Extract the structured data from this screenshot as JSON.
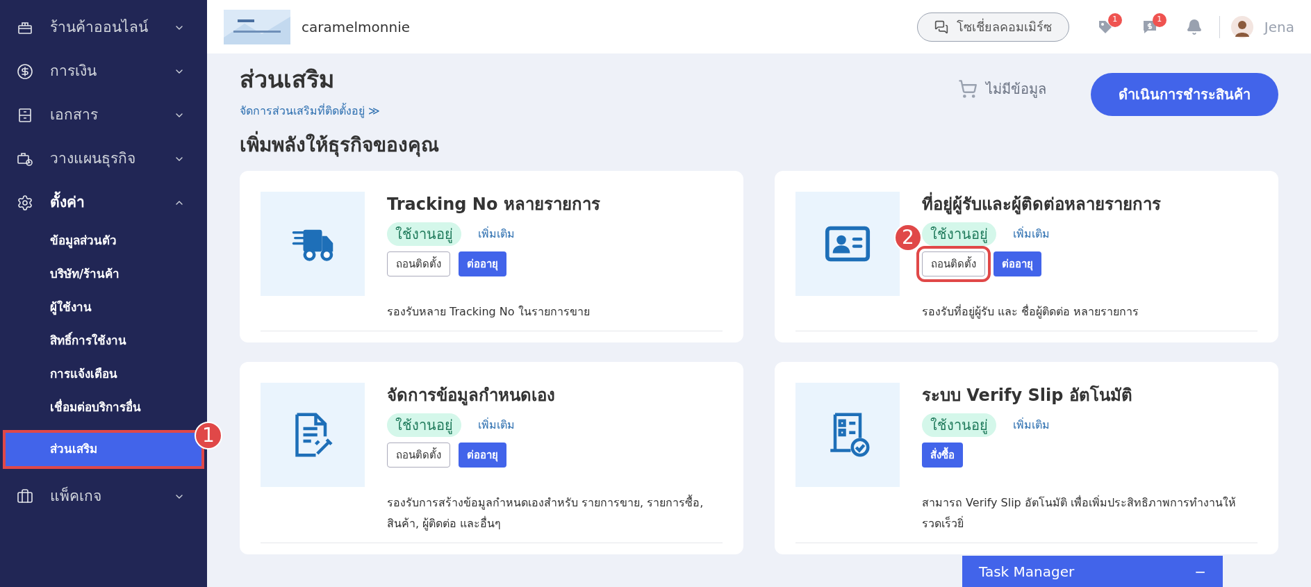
{
  "sidebar": {
    "items": [
      {
        "kind": "menu",
        "label": "ร้านค้าออนไลน์",
        "expanded": false
      },
      {
        "kind": "menu",
        "label": "การเงิน",
        "expanded": false
      },
      {
        "kind": "menu",
        "label": "เอกสาร",
        "expanded": false
      },
      {
        "kind": "menu",
        "label": "วางแผนธุรกิจ",
        "expanded": false
      },
      {
        "kind": "menu",
        "label": "ตั้งค่า",
        "expanded": true,
        "children": [
          {
            "label": "ข้อมูลส่วนตัว",
            "selected": false
          },
          {
            "label": "บริษัท/ร้านค้า",
            "selected": false
          },
          {
            "label": "ผู้ใช้งาน",
            "selected": false
          },
          {
            "label": "สิทธิ์การใช้งาน",
            "selected": false
          },
          {
            "label": "การแจ้งเตือน",
            "selected": false
          },
          {
            "label": "เชื่อมต่อบริการอื่น",
            "selected": false
          },
          {
            "label": "ส่วนเสริม",
            "selected": true,
            "callout": "1"
          }
        ]
      },
      {
        "kind": "menu",
        "label": "แพ็คเกจ",
        "expanded": false
      }
    ]
  },
  "header": {
    "shop_name": "caramelmonnie",
    "social_button": "โซเชี่ยลคอมเมิร์ซ",
    "badges": [
      {
        "count": "1"
      },
      {
        "count": "1"
      }
    ],
    "user": "Jena"
  },
  "page": {
    "title": "ส่วนเสริม",
    "manage_link": "จัดการส่วนเสริมที่ติดตั้งอยู่ ≫",
    "cart": "ไม่มีข้อมูล",
    "checkout_button": "ดำเนินการชำระสินค้า",
    "section_title": "เพิ่มพลังให้ธุรกิจของคุณ"
  },
  "addons": [
    {
      "title": "Tracking No หลายรายการ",
      "status": "ใช้งานอยู่",
      "more": "เพิ่มเติม",
      "buttons": [
        {
          "kind": "outline",
          "label": "ถอนติดตั้ง"
        },
        {
          "kind": "primary",
          "label": "ต่ออายุ"
        }
      ],
      "description": "รองรับหลาย Tracking No ในรายการขาย"
    },
    {
      "title": "ที่อยู่ผู้รับและผู้ติดต่อหลายรายการ",
      "status": "ใช้งานอยู่",
      "more": "เพิ่มเติม",
      "buttons": [
        {
          "kind": "outline",
          "label": "ถอนติดตั้ง",
          "callout": "2"
        },
        {
          "kind": "primary",
          "label": "ต่ออายุ"
        }
      ],
      "description": "รองรับที่อยู่ผู้รับ และ ชื่อผู้ติดต่อ หลายรายการ"
    },
    {
      "title": "จัดการข้อมูลกำหนดเอง",
      "status": "ใช้งานอยู่",
      "more": "เพิ่มเติม",
      "buttons": [
        {
          "kind": "outline",
          "label": "ถอนติดตั้ง"
        },
        {
          "kind": "primary",
          "label": "ต่ออายุ"
        }
      ],
      "description": "รองรับการสร้างข้อมูลกำหนดเองสำหรับ รายการขาย, รายการซื้อ, สินค้า, ผู้ติดต่อ และอื่นๆ"
    },
    {
      "title": "ระบบ Verify Slip อัตโนมัติ",
      "status": "ใช้งานอยู่",
      "more": "เพิ่มเติม",
      "buttons": [
        {
          "kind": "primary",
          "label": "สั่งซื้อ"
        }
      ],
      "description": "สามารถ Verify Slip อัตโนมัติ เพื่อเพิ่มประสิทธิภาพการทำงานให้ รวดเร็วยิ่"
    }
  ],
  "task_manager": {
    "title": "Task Manager",
    "toggle": "−"
  }
}
